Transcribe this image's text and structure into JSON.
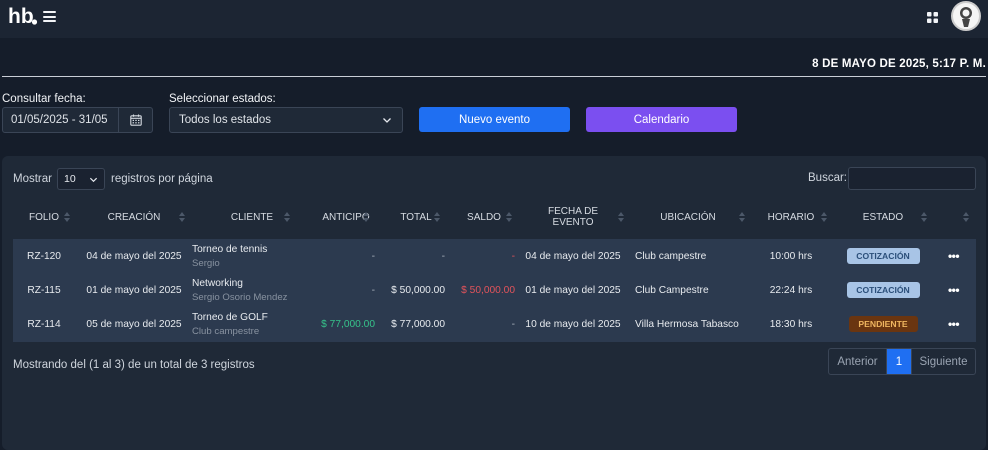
{
  "header": {
    "logo_text": "hb",
    "datetime": "8 DE MAYO DE 2025, 5:17 P. M."
  },
  "filters": {
    "date_label": "Consultar fecha:",
    "date_value": "01/05/2025 - 31/05",
    "state_label": "Seleccionar estados:",
    "state_value": "Todos los estados",
    "new_event_label": "Nuevo evento",
    "calendar_label": "Calendario"
  },
  "table_controls": {
    "show_label": "Mostrar",
    "per_page_value": "10",
    "per_page_suffix": "registros por página",
    "search_label": "Buscar:"
  },
  "columns": [
    "FOLIO",
    "CREACIÓN",
    "CLIENTE",
    "ANTICIPO",
    "TOTAL",
    "SALDO",
    "FECHA DE EVENTO",
    "UBICACIÓN",
    "HORARIO",
    "ESTADO"
  ],
  "rows": [
    {
      "folio": "RZ-120",
      "creacion": "04 de mayo del 2025",
      "cliente": "Torneo de tennis",
      "cliente_sub": "Sergio",
      "anticipo": "-",
      "total": "-",
      "saldo": "-",
      "fecha_evento": "04 de mayo del 2025",
      "ubicacion": "Club campestre",
      "horario": "10:00 hrs",
      "estado": "COTIZACIÓN"
    },
    {
      "folio": "RZ-115",
      "creacion": "01 de mayo del 2025",
      "cliente": "Networking",
      "cliente_sub": "Sergio Osorio Mendez",
      "anticipo": "-",
      "total": "$ 50,000.00",
      "saldo": "$ 50,000.00",
      "fecha_evento": "01 de mayo del 2025",
      "ubicacion": "Club Campestre",
      "horario": "22:24 hrs",
      "estado": "COTIZACIÓN"
    },
    {
      "folio": "RZ-114",
      "creacion": "05 de mayo del 2025",
      "cliente": "Torneo de GOLF",
      "cliente_sub": "Club campestre",
      "anticipo": "$ 77,000.00",
      "total": "$ 77,000.00",
      "saldo": "-",
      "fecha_evento": "10 de mayo del 2025",
      "ubicacion": "Villa Hermosa Tabasco",
      "horario": "18:30 hrs",
      "estado": "PENDIENTE"
    }
  ],
  "footer": {
    "info": "Mostrando del (1 al 3) de un total de 3 registros",
    "prev_label": "Anterior",
    "current_page": "1",
    "next_label": "Siguiente"
  },
  "colors": {
    "primary_blue": "#1f6ff2",
    "purple": "#7b4ff0",
    "green": "#36c28a",
    "red": "#e2535b",
    "badge_cotizacion": "#a8c4e6",
    "badge_pendiente": "#6a3510"
  }
}
